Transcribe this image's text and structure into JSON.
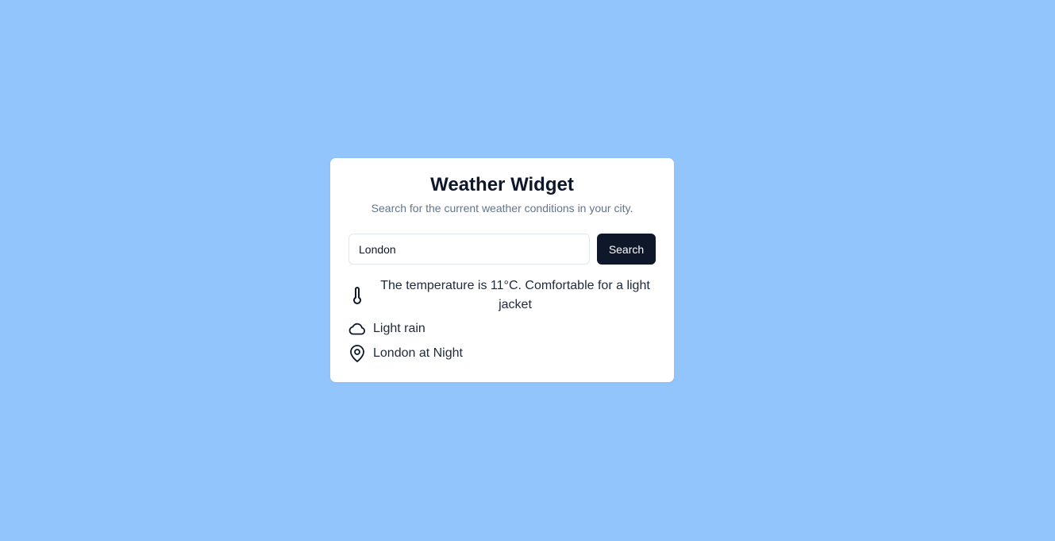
{
  "widget": {
    "title": "Weather Widget",
    "subtitle": "Search for the current weather conditions in your city."
  },
  "search": {
    "value": "London",
    "placeholder": "",
    "button_label": "Search"
  },
  "results": {
    "temperature_text": "The temperature is 11°C. Comfortable for a light jacket",
    "temperature_icon": "thermometer-icon",
    "condition_text": "Light rain",
    "condition_icon": "cloud-icon",
    "location_text": "London at Night",
    "location_icon": "map-pin-icon"
  },
  "colors": {
    "background": "#93c5fd",
    "card": "#ffffff",
    "button": "#0f172a",
    "button_text": "#ffffff",
    "subtitle": "#64748b"
  }
}
